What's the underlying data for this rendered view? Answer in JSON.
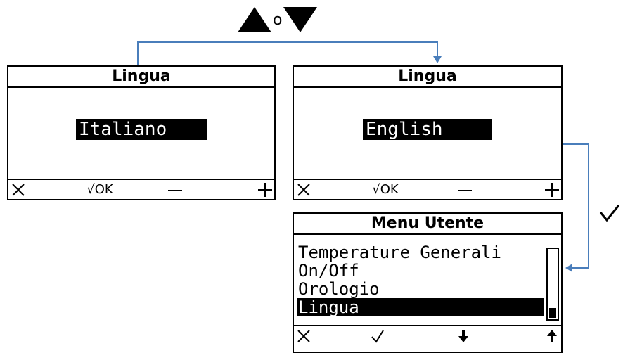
{
  "nav_hint": {
    "connector": "o",
    "up_icon": "triangle-up-icon",
    "down_icon": "triangle-down-icon"
  },
  "screens": [
    {
      "title": "Lingua",
      "value": "Italiano"
    },
    {
      "title": "Lingua",
      "value": "English"
    }
  ],
  "footer": {
    "cancel_icon": "x-icon",
    "ok_label": "√OK",
    "minus_icon": "minus-icon",
    "plus_icon": "plus-icon"
  },
  "menu": {
    "title": "Menu Utente",
    "items": [
      "Temperature Generali",
      "On/Off",
      "Orologio",
      "Lingua"
    ],
    "selected_index": 3,
    "footer": {
      "cancel_icon": "x-icon",
      "ok_icon": "check-icon",
      "down_icon": "arrow-down-icon",
      "up_icon": "arrow-up-icon"
    }
  },
  "confirm_icon": "checkmark-icon",
  "colors": {
    "connector": "#4a7ebb",
    "background": "#ffffff",
    "display": "#000000"
  }
}
